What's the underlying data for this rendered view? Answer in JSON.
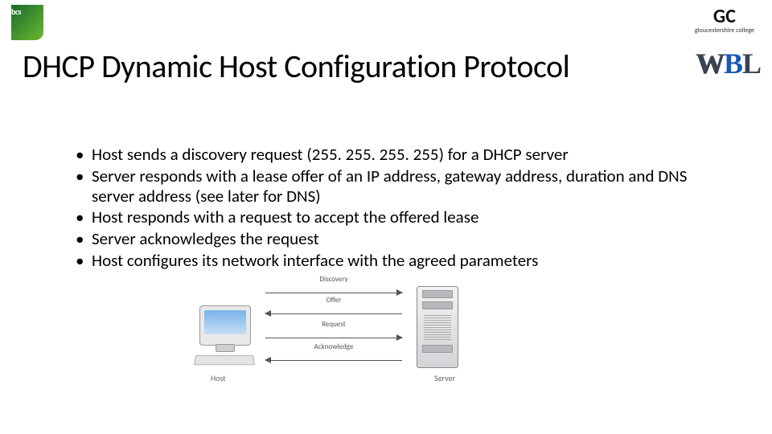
{
  "logos": {
    "bcs": "bcs",
    "gc_main": "GC",
    "gc_sub": "gloucestershire college",
    "wbl_w": "W",
    "wbl_b": "B",
    "wbl_l": "L"
  },
  "title": "DHCP Dynamic Host Configuration Protocol",
  "bullets": [
    "Host sends a discovery request (255. 255. 255. 255) for a DHCP server",
    "Server responds with a lease offer of an IP address, gateway address, duration and DNS server address (see later for DNS)",
    "Host responds with a request to accept the offered lease",
    "Server acknowledges the request",
    "Host configures its network interface with the agreed parameters"
  ],
  "diagram": {
    "host_label": "Host",
    "server_label": "Server",
    "arrows": {
      "discovery": "Discovery",
      "offer": "Offer",
      "request": "Request",
      "acknowledge": "Acknowledge"
    }
  }
}
